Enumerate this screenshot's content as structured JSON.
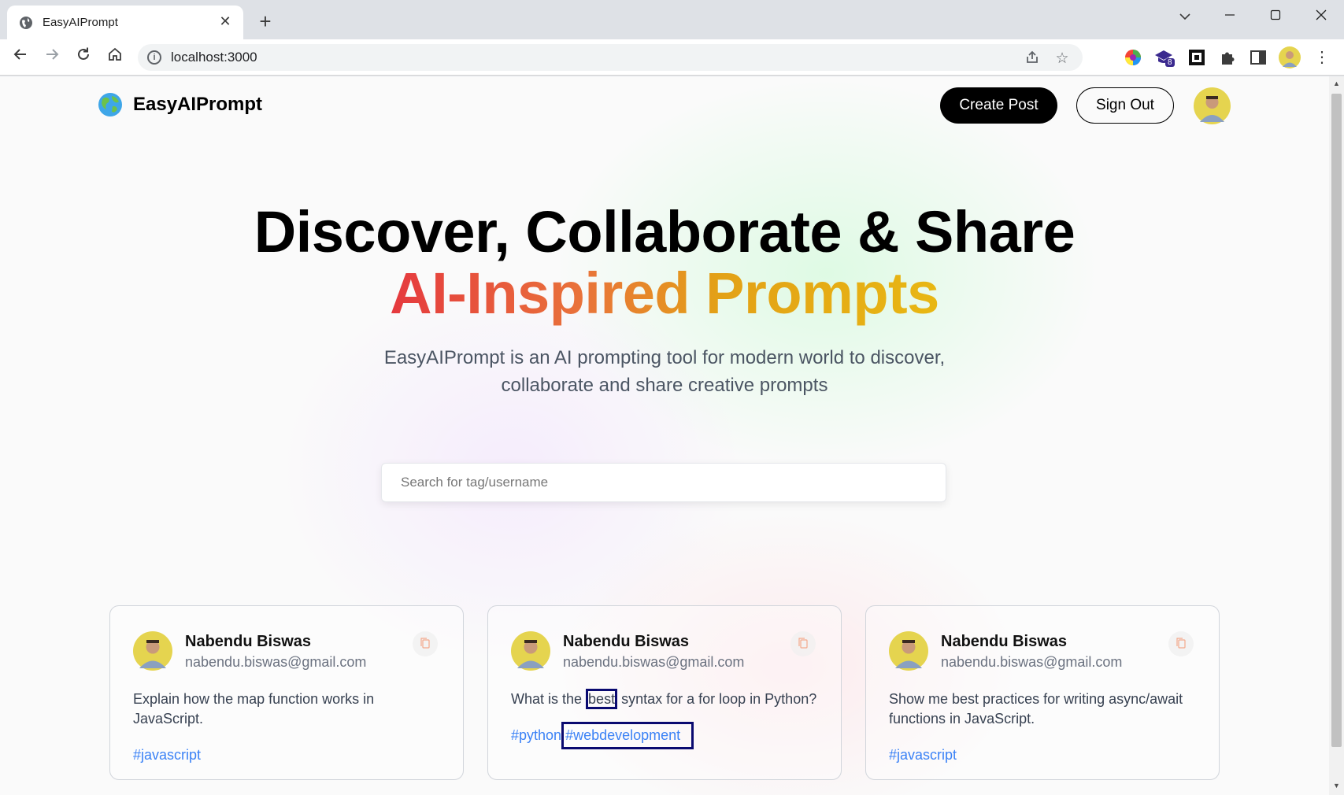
{
  "browser": {
    "tab_title": "EasyAIPrompt",
    "url": "localhost:3000",
    "extension_badge": "8"
  },
  "header": {
    "brand": "EasyAIPrompt",
    "create_post_label": "Create Post",
    "sign_out_label": "Sign Out"
  },
  "hero": {
    "title_line1": "Discover, Collaborate & Share",
    "title_line2": "AI-Inspired Prompts",
    "description": "EasyAIPrompt is an AI prompting tool for modern world to discover, collaborate and share creative prompts"
  },
  "search": {
    "placeholder": "Search for tag/username"
  },
  "cards": [
    {
      "name": "Nabendu Biswas",
      "email": "nabendu.biswas@gmail.com",
      "prompt": "Explain how the map function works in JavaScript.",
      "tags": [
        "#javascript"
      ]
    },
    {
      "name": "Nabendu Biswas",
      "email": "nabendu.biswas@gmail.com",
      "prompt_before": "What is the ",
      "prompt_highlight": "best",
      "prompt_after": " syntax for a for loop in Python?",
      "tags": [
        "#python",
        "#webdevelopment"
      ]
    },
    {
      "name": "Nabendu Biswas",
      "email": "nabendu.biswas@gmail.com",
      "prompt": "Show me best practices for writing async/await functions in JavaScript.",
      "tags": [
        "#javascript"
      ]
    }
  ],
  "colors": {
    "accent_gradient": [
      "#e5393e",
      "#e9733a",
      "#e3a116",
      "#e8b713"
    ],
    "tag_color": "#3b82f6"
  }
}
